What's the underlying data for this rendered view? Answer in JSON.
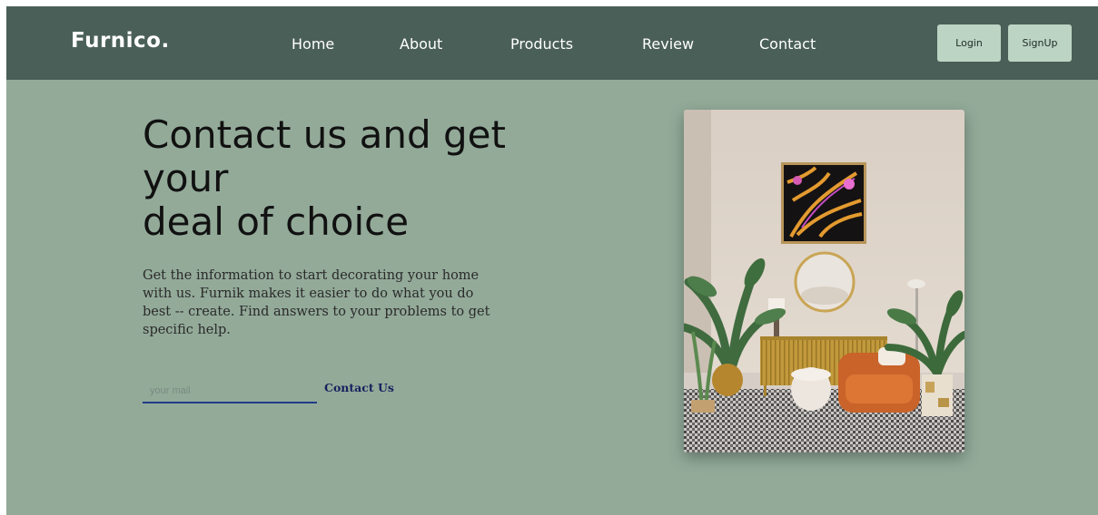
{
  "brand": "Furnico.",
  "nav": {
    "links": [
      "Home",
      "About",
      "Products",
      "Review",
      "Contact"
    ],
    "login_label": "Login",
    "signup_label": "SignUp"
  },
  "hero": {
    "title_line1": "Contact us and get",
    "title_line2": "your",
    "title_line3": "deal of choice",
    "description": "Get the information to start decorating your home with us. Furnik makes it easier to do what you do best -- create. Find answers to your problems to get specific help.",
    "email_placeholder": "your mail",
    "contact_label": "Contact Us"
  },
  "colors": {
    "navbar": "#4a5f57",
    "page_background": "#93aa99",
    "nav_button": "#bcd4c4",
    "input_underline": "#1f3b8a",
    "contact_text": "#16215e"
  }
}
